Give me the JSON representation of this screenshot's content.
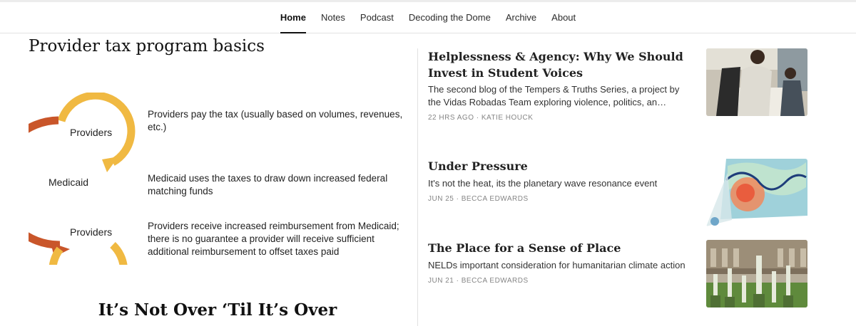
{
  "nav": {
    "items": [
      {
        "label": "Home",
        "active": true
      },
      {
        "label": "Notes"
      },
      {
        "label": "Podcast"
      },
      {
        "label": "Decoding the Dome"
      },
      {
        "label": "Archive"
      },
      {
        "label": "About"
      }
    ]
  },
  "featured": {
    "slide_title": "Provider tax program basics",
    "cycle_labels": [
      "Providers",
      "Medicaid",
      "Providers"
    ],
    "descriptions": [
      "Providers pay the tax (usually based on volumes, revenues, etc.)",
      "Medicaid uses the taxes to draw down increased federal matching funds",
      "Providers receive increased reimbursement from Medicaid; there is no guarantee a provider will receive sufficient additional reimbursement to offset taxes paid"
    ],
    "post_title": "It’s Not Over ‘Til It’s Over",
    "colors": {
      "arrow_yellow": "#f0b942",
      "arrow_orange": "#c9562a"
    }
  },
  "posts": [
    {
      "title": "Helplessness & Agency: Why We Should Invest in Student Voices",
      "subtitle": "The second blog of the Tempers & Truths Series, a project by the Vidas Robadas Team exploring violence, politics, an…",
      "meta": "22 HRS AGO · KATIE HOUCK",
      "thumb": "students-photo"
    },
    {
      "title": "Under Pressure",
      "subtitle": "It's not the heat, its the planetary wave resonance event",
      "meta": "JUN 25 · BECCA EDWARDS",
      "thumb": "weather-map"
    },
    {
      "title": "The Place for a Sense of Place",
      "subtitle": "NELDs important consideration for humanitarian climate action",
      "meta": "JUN 21 · BECCA EDWARDS",
      "thumb": "cloister-garden-photo"
    }
  ]
}
